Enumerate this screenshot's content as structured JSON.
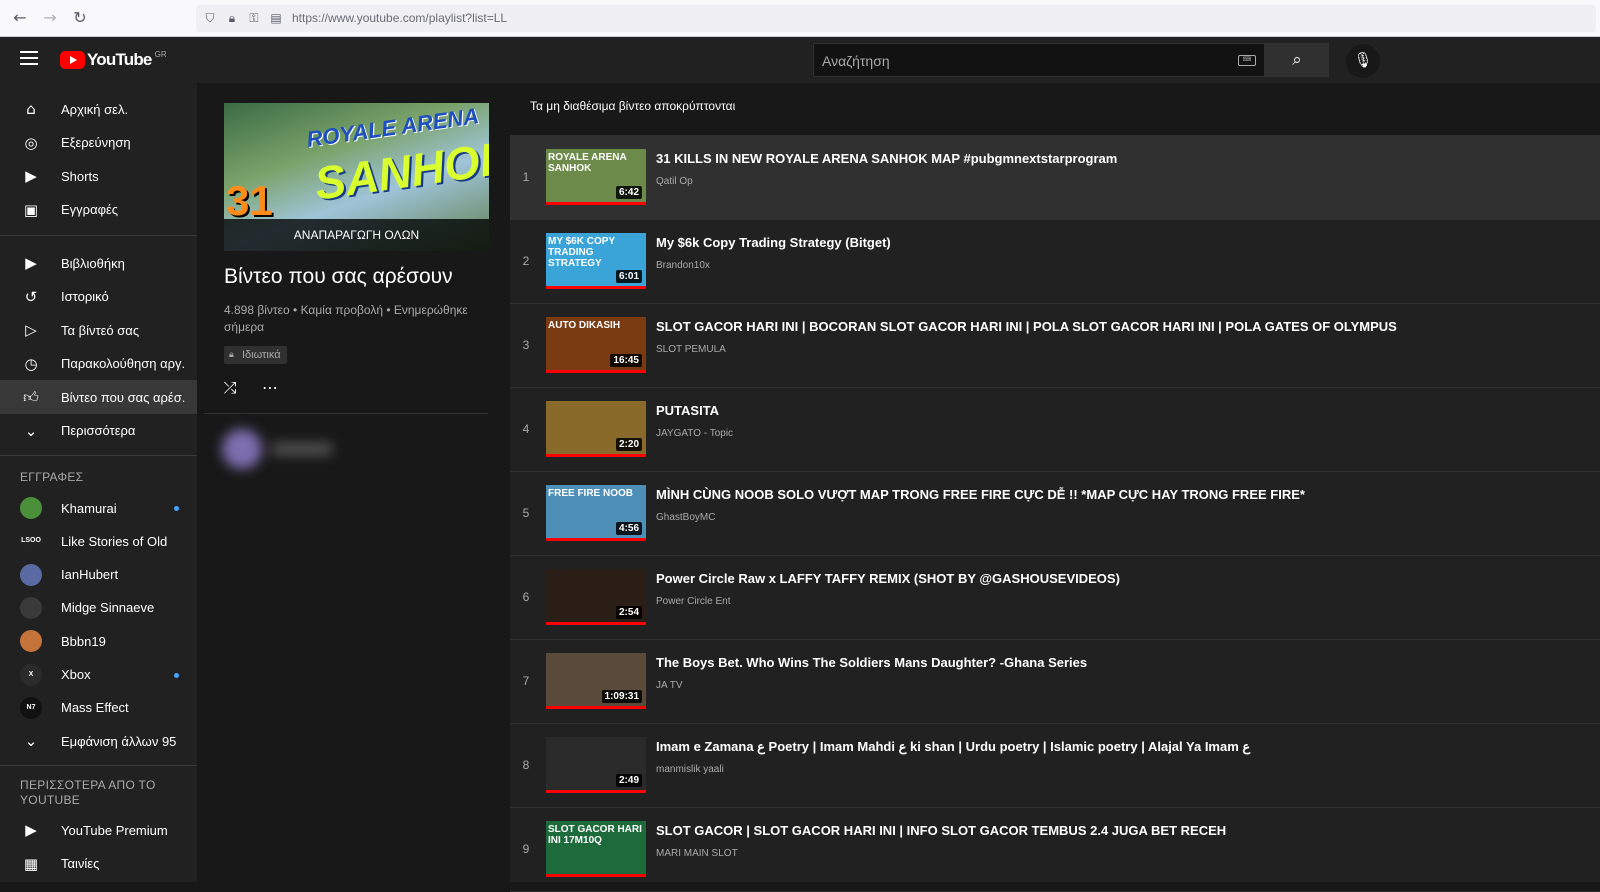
{
  "browser": {
    "url": "https://www.youtube.com/playlist?list=LL"
  },
  "header": {
    "logo_text": "YouTube",
    "country_code": "GR",
    "search_placeholder": "Αναζήτηση"
  },
  "sidebar": {
    "main": [
      {
        "label": "Αρχική σελ.",
        "icon": "home-icon"
      },
      {
        "label": "Εξερεύνηση",
        "icon": "compass-icon"
      },
      {
        "label": "Shorts",
        "icon": "shorts-icon"
      },
      {
        "label": "Εγγραφές",
        "icon": "subscriptions-icon"
      }
    ],
    "library": [
      {
        "label": "Βιβλιοθήκη",
        "icon": "library-icon"
      },
      {
        "label": "Ιστορικό",
        "icon": "history-icon"
      },
      {
        "label": "Τα βίντεό σας",
        "icon": "your-videos-icon"
      },
      {
        "label": "Παρακολούθηση αργ...",
        "icon": "watch-later-icon"
      },
      {
        "label": "Βίντεο που σας αρέσ...",
        "icon": "thumbs-up-icon"
      },
      {
        "label": "Περισσότερα",
        "icon": "chevron-down-icon"
      }
    ],
    "subs_heading": "ΕΓΓΡΑΦΕΣ",
    "subscriptions": [
      {
        "label": "Khamurai",
        "avatar_color": "#4b8f3a",
        "avatar_text": "",
        "new": true
      },
      {
        "label": "Like Stories of Old",
        "avatar_color": "#222222",
        "avatar_text": "LSOO",
        "new": false
      },
      {
        "label": "IanHubert",
        "avatar_color": "#5a6aa3",
        "avatar_text": "",
        "new": false
      },
      {
        "label": "Midge Sinnaeve",
        "avatar_color": "#3a3a3a",
        "avatar_text": "",
        "new": false
      },
      {
        "label": "Bbbn19",
        "avatar_color": "#c4743a",
        "avatar_text": "",
        "new": false
      },
      {
        "label": "Xbox",
        "avatar_color": "#2b2b2b",
        "avatar_text": "X",
        "new": true
      },
      {
        "label": "Mass Effect",
        "avatar_color": "#111111",
        "avatar_text": "N7",
        "new": false
      }
    ],
    "show_more": "Εμφάνιση άλλων 95",
    "more_heading": "ΠΕΡΙΣΣΟΤΕΡΑ ΑΠΟ ΤΟ YOUTUBE",
    "more_items": [
      {
        "label": "YouTube Premium",
        "icon": "youtube-premium-icon"
      },
      {
        "label": "Ταινίες",
        "icon": "movies-icon"
      }
    ]
  },
  "playlist": {
    "thumb_text_1": "ROYALE ARENA",
    "thumb_text_2": "SANHOK",
    "thumb_text_3": "31",
    "play_all": "ΑΝΑΠΑΡΑΓΩΓΗ ΟΛΩΝ",
    "title": "Βίντεο που σας αρέσουν",
    "meta": "4.898 βίντεο • Καμία προβολή • Ενημερώθηκε σήμερα",
    "privacy": "Ιδιωτικά"
  },
  "main": {
    "notice": "Τα μη διαθέσιμα βίντεο αποκρύπτονται",
    "videos": [
      {
        "index": "1",
        "title": "31 KILLS IN NEW ROYALE ARENA SANHOK MAP #pubgmnextstarprogram",
        "channel": "Qatil Op",
        "duration": "6:42",
        "thumb_bg": "#6c8a4a",
        "thumb_text": "ROYALE ARENA SANHOK",
        "selected": true
      },
      {
        "index": "2",
        "title": "My $6k Copy Trading Strategy (Bitget)",
        "channel": "Brandon10x",
        "duration": "6:01",
        "thumb_bg": "#3aa4d8",
        "thumb_text": "MY $6K COPY TRADING STRATEGY",
        "selected": false
      },
      {
        "index": "3",
        "title": "SLOT GACOR HARI INI | BOCORAN SLOT GACOR HARI INI | POLA SLOT GACOR HARI INI | POLA GATES OF OLYMPUS",
        "channel": "SLOT PEMULA",
        "duration": "16:45",
        "thumb_bg": "#7a3a12",
        "thumb_text": "AUTO DIKASIH",
        "selected": false
      },
      {
        "index": "4",
        "title": "PUTASITA",
        "channel": "JAYGATO - Topic",
        "duration": "2:20",
        "thumb_bg": "#8a6a2a",
        "thumb_text": "",
        "selected": false
      },
      {
        "index": "5",
        "title": "MÌNH CÙNG NOOB SOLO VƯỢT MAP TRONG FREE FIRE CỰC DỄ !! *MAP CỰC HAY TRONG FREE FIRE*",
        "channel": "GhastBoyMC",
        "duration": "4:56",
        "thumb_bg": "#4e8fb8",
        "thumb_text": "FREE FIRE NOOB",
        "selected": false
      },
      {
        "index": "6",
        "title": "Power Circle Raw x LAFFY TAFFY REMIX (SHOT BY @GASHOUSEVIDEOS)",
        "channel": "Power Circle Ent",
        "duration": "2:54",
        "thumb_bg": "#2a1e16",
        "thumb_text": "",
        "selected": false
      },
      {
        "index": "7",
        "title": "The Boys Bet. Who Wins The Soldiers Mans Daughter? -Ghana Series",
        "channel": "JA TV",
        "duration": "1:09:31",
        "thumb_bg": "#5a4a3a",
        "thumb_text": "",
        "selected": false
      },
      {
        "index": "8",
        "title": "Imam e Zamana ع Poetry | Imam Mahdi ع ki shan | Urdu poetry | Islamic poetry | Alajal Ya Imam ع",
        "channel": "manmislik yaali",
        "duration": "2:49",
        "thumb_bg": "#2a2a2a",
        "thumb_text": "",
        "selected": false
      },
      {
        "index": "9",
        "title": "SLOT GACOR | SLOT GACOR HARI INI | INFO SLOT GACOR TEMBUS 2.4 JUGA BET RECEH",
        "channel": "MARI MAIN SLOT",
        "duration": "",
        "thumb_bg": "#1d6b3a",
        "thumb_text": "SLOT GACOR HARI INI 17M10Q",
        "selected": false
      }
    ]
  }
}
